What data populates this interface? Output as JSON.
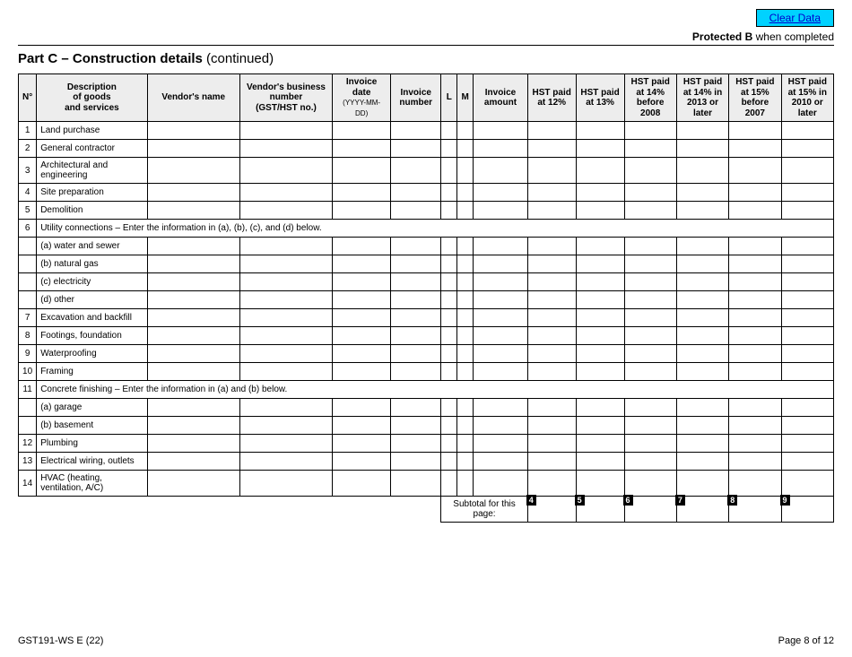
{
  "top": {
    "clear_data": "Clear Data",
    "protected": "Protected B",
    "when_completed": " when completed"
  },
  "section": {
    "part": "Part C – Construction details",
    "continued": " (continued)"
  },
  "headers": {
    "n": "N°",
    "desc": "Description\nof goods\nand services",
    "vendor": "Vendor's name",
    "bn": "Vendor's business number\n(GST/HST no.)",
    "date": "Invoice date (YYYY-MM-DD)",
    "invnum": "Invoice number",
    "l": "L",
    "m": "M",
    "amount": "Invoice amount",
    "hst12": "HST paid at 12%",
    "hst13": "HST paid at 13%",
    "hst14a": "HST paid at 14% before 2008",
    "hst14b": "HST paid at 14% in 2013 or later",
    "hst15a": "HST paid at 15% before 2007",
    "hst15b": "HST paid at 15% in 2010 or later"
  },
  "rows": [
    {
      "n": "1",
      "desc": "Land purchase",
      "span": 1
    },
    {
      "n": "2",
      "desc": "General contractor",
      "span": 1
    },
    {
      "n": "3",
      "desc": "Architectural and engineering",
      "span": 1
    },
    {
      "n": "4",
      "desc": "Site preparation",
      "span": 1
    },
    {
      "n": "5",
      "desc": "Demolition",
      "span": 1
    },
    {
      "n": "6",
      "desc": "Utility connections – Enter the information in (a), (b), (c), and (d) below.",
      "span": 14
    },
    {
      "n": "",
      "desc": "(a) water and sewer",
      "span": 1
    },
    {
      "n": "",
      "desc": "(b) natural gas",
      "span": 1
    },
    {
      "n": "",
      "desc": "(c) electricity",
      "span": 1
    },
    {
      "n": "",
      "desc": "(d) other",
      "span": 1
    },
    {
      "n": "7",
      "desc": "Excavation and backfill",
      "span": 1
    },
    {
      "n": "8",
      "desc": "Footings, foundation",
      "span": 1
    },
    {
      "n": "9",
      "desc": "Waterproofing",
      "span": 1
    },
    {
      "n": "10",
      "desc": "Framing",
      "span": 1
    },
    {
      "n": "11",
      "desc": "Concrete finishing – Enter the information in (a) and (b) below.",
      "span": 14
    },
    {
      "n": "",
      "desc": "(a) garage",
      "span": 1
    },
    {
      "n": "",
      "desc": "(b) basement",
      "span": 1
    },
    {
      "n": "12",
      "desc": "Plumbing",
      "span": 1
    },
    {
      "n": "13",
      "desc": "Electrical wiring, outlets",
      "span": 1
    },
    {
      "n": "14",
      "desc": "HVAC (heating, ventilation, A/C)",
      "span": 1
    }
  ],
  "subtotal": {
    "label": "Subtotal for this page:",
    "flags": [
      "4",
      "5",
      "6",
      "7",
      "8",
      "9"
    ]
  },
  "footer": {
    "form": "GST191-WS E (22)",
    "page": "Page 8 of 12"
  }
}
